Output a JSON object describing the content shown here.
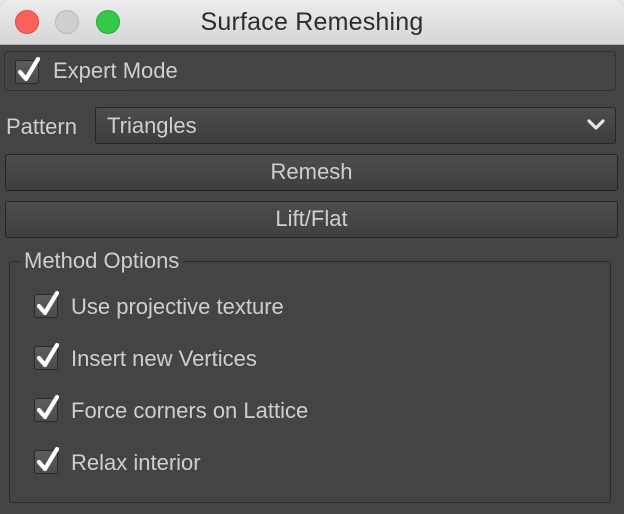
{
  "window": {
    "title": "Surface Remeshing",
    "controls": [
      "close-icon",
      "minimize-icon",
      "maximize-icon"
    ]
  },
  "expert_mode": {
    "label": "Expert Mode",
    "checked": true
  },
  "pattern": {
    "label": "Pattern",
    "selected": "Triangles"
  },
  "buttons": {
    "remesh": "Remesh",
    "lift_flat": "Lift/Flat"
  },
  "method_options": {
    "title": "Method Options",
    "items": [
      {
        "label": "Use projective texture",
        "checked": true
      },
      {
        "label": "Insert new Vertices",
        "checked": true
      },
      {
        "label": "Force corners on Lattice",
        "checked": true
      },
      {
        "label": "Relax interior",
        "checked": true
      }
    ]
  },
  "colors": {
    "panel_bg": "#444444",
    "text": "#cfcfcf",
    "close": "#fc605c",
    "maximize": "#34c84a"
  }
}
